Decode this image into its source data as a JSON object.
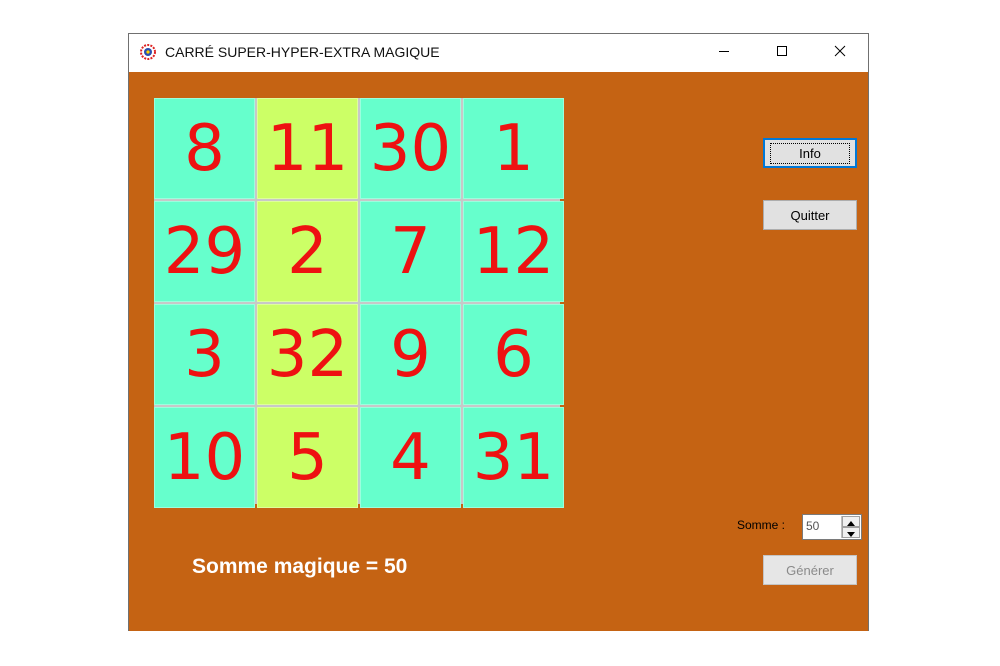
{
  "window": {
    "title": "CARRÉ SUPER-HYPER-EXTRA MAGIQUE",
    "app_icon": "app-logo-icon",
    "controls": [
      "minimize-icon",
      "maximize-icon",
      "close-icon"
    ]
  },
  "colors": {
    "background": "#c56313",
    "cell_teal": "#66ffcc",
    "cell_lime": "#ccff66",
    "digit": "#ee1111"
  },
  "grid": {
    "rows": [
      [
        "8",
        "11",
        "30",
        "1"
      ],
      [
        "29",
        "2",
        "7",
        "12"
      ],
      [
        "3",
        "32",
        "9",
        "6"
      ],
      [
        "10",
        "5",
        "4",
        "31"
      ]
    ],
    "highlighted_column": 1
  },
  "buttons": {
    "info": "Info",
    "quit": "Quitter",
    "generate": "Générer"
  },
  "somme": {
    "label": "Somme :",
    "value": "50"
  },
  "magic_sum_text": "Somme magique = 50"
}
